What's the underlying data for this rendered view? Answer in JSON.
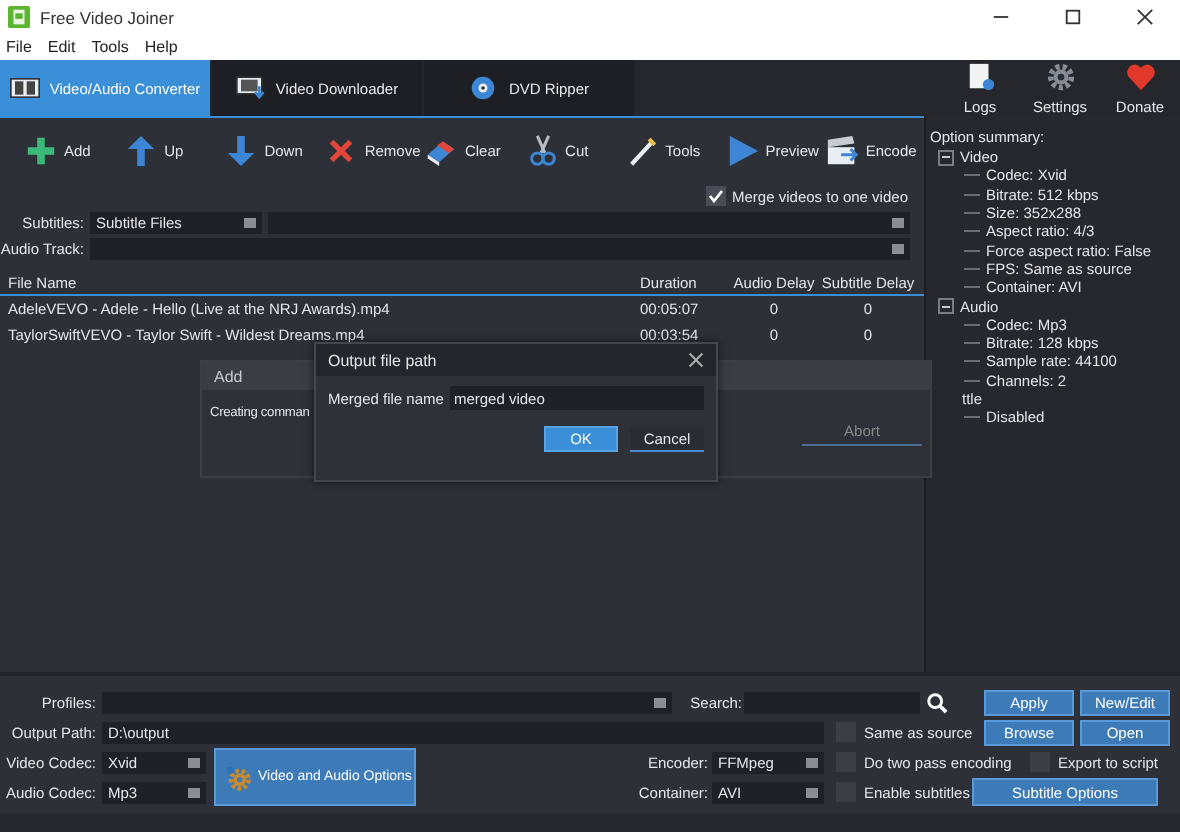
{
  "window": {
    "title": "Free Video Joiner"
  },
  "menu": [
    "File",
    "Edit",
    "Tools",
    "Help"
  ],
  "tabs": [
    {
      "label": "Video/Audio Converter",
      "selected": true,
      "kind": "film"
    },
    {
      "label": "Video Downloader",
      "selected": false,
      "kind": "download"
    },
    {
      "label": "DVD Ripper",
      "selected": false,
      "kind": "disc"
    }
  ],
  "top_actions": [
    {
      "label": "Logs",
      "kind": "logs"
    },
    {
      "label": "Settings",
      "kind": "settings"
    },
    {
      "label": "Donate",
      "kind": "donate"
    }
  ],
  "toolbar": [
    {
      "label": "Add",
      "kind": "add"
    },
    {
      "label": "Up",
      "kind": "up"
    },
    {
      "label": "Down",
      "kind": "down"
    },
    {
      "label": "Remove",
      "kind": "remove"
    },
    {
      "label": "Clear",
      "kind": "clear"
    },
    {
      "label": "Cut",
      "kind": "cut"
    },
    {
      "label": "Tools",
      "kind": "tools"
    },
    {
      "label": "Preview",
      "kind": "preview"
    },
    {
      "label": "Encode",
      "kind": "encode"
    }
  ],
  "merge_checkbox": {
    "label": "Merge videos to one video",
    "checked": true
  },
  "subtitles": {
    "label": "Subtitles:",
    "value": "Subtitle Files"
  },
  "audio_track": {
    "label": "Audio Track:"
  },
  "table": {
    "columns": [
      "File Name",
      "Duration",
      "Audio Delay",
      "Subtitle Delay"
    ],
    "rows": [
      [
        "AdeleVEVO - Adele - Hello (Live at the NRJ Awards).mp4",
        "00:05:07",
        "0",
        "0"
      ],
      [
        "TaylorSwiftVEVO - Taylor Swift - Wildest Dreams.mp4",
        "00:03:54",
        "0",
        "0"
      ]
    ]
  },
  "option_summary": {
    "title": "Option summary:",
    "tree": [
      {
        "label": "Video",
        "expanded": true,
        "children": [
          {
            "label": "Codec: Xvid"
          },
          {
            "label": "Bitrate: 512 kbps"
          },
          {
            "label": "Size: 352x288"
          },
          {
            "label": "Aspect ratio: 4/3"
          },
          {
            "label": "Force aspect ratio: False"
          },
          {
            "label": "FPS: Same as source"
          },
          {
            "label": "Container: AVI"
          }
        ]
      },
      {
        "label": "Audio",
        "expanded": true,
        "children": [
          {
            "label": "Codec: Mp3"
          },
          {
            "label": "Bitrate: 128 kbps"
          },
          {
            "label": "Sample rate: 44100"
          },
          {
            "label": "Channels: 2"
          }
        ]
      },
      {
        "label": "ttle",
        "children": [
          {
            "label": "Disabled"
          }
        ]
      }
    ]
  },
  "add_dialog": {
    "title": "Add",
    "text": "Creating comman",
    "button": "Abort"
  },
  "output_dialog": {
    "title": "Output file path",
    "field_label": "Merged file name",
    "value": "merged video",
    "buttons": [
      {
        "label": "OK",
        "primary": true
      },
      {
        "label": "Cancel",
        "primary": false
      }
    ]
  },
  "profiles": {
    "label": "Profiles:"
  },
  "search": {
    "label": "Search:"
  },
  "output_path": {
    "label": "Output Path:",
    "value": "D:\\output"
  },
  "video_codec": {
    "label": "Video Codec:",
    "value": "Xvid"
  },
  "audio_codec": {
    "label": "Audio Codec:",
    "value": "Mp3"
  },
  "encoder": {
    "label": "Encoder:",
    "value": "FFMpeg"
  },
  "container": {
    "label": "Container:",
    "value": "AVI"
  },
  "options": [
    {
      "label": "Same as source",
      "checked": false
    },
    {
      "label": "Do two pass encoding",
      "checked": false
    },
    {
      "label": "Enable subtitles",
      "checked": false
    },
    {
      "label": "Export to script",
      "checked": false
    }
  ],
  "buttons": {
    "apply": "Apply",
    "new_edit": "New/Edit",
    "browse": "Browse",
    "open": "Open",
    "subtitle_options": "Subtitle Options",
    "video_audio_options": "Video and Audio Options"
  }
}
